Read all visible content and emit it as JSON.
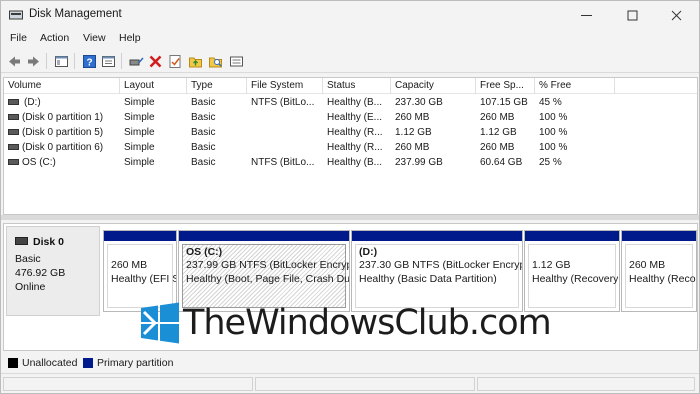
{
  "window": {
    "title": "Disk Management",
    "minimize_icon": "minimize-icon",
    "maximize_icon": "maximize-icon",
    "close_icon": "close-icon"
  },
  "menu": [
    "File",
    "Action",
    "View",
    "Help"
  ],
  "toolbar": {
    "icons": [
      "back-arrow-icon",
      "forward-arrow-icon",
      "console-tree-icon",
      "help-icon",
      "properties-icon",
      "connect-drive-icon",
      "delete-icon",
      "check-icon",
      "folder-up-icon",
      "search-icon",
      "list-view-icon"
    ]
  },
  "volume_table": {
    "columns": [
      "Volume",
      "Layout",
      "Type",
      "File System",
      "Status",
      "Capacity",
      "Free Sp...",
      "% Free"
    ],
    "rows": [
      {
        "volume": "(D:)",
        "layout": "Simple",
        "type": "Basic",
        "file_system": "NTFS (BitLo...",
        "status": "Healthy (B...",
        "capacity": "237.30 GB",
        "free": "107.15 GB",
        "pct": "45 %"
      },
      {
        "volume": "(Disk 0 partition 1)",
        "layout": "Simple",
        "type": "Basic",
        "file_system": "",
        "status": "Healthy (E...",
        "capacity": "260 MB",
        "free": "260 MB",
        "pct": "100 %"
      },
      {
        "volume": "(Disk 0 partition 5)",
        "layout": "Simple",
        "type": "Basic",
        "file_system": "",
        "status": "Healthy (R...",
        "capacity": "1.12 GB",
        "free": "1.12 GB",
        "pct": "100 %"
      },
      {
        "volume": "(Disk 0 partition 6)",
        "layout": "Simple",
        "type": "Basic",
        "file_system": "",
        "status": "Healthy (R...",
        "capacity": "260 MB",
        "free": "260 MB",
        "pct": "100 %"
      },
      {
        "volume": "OS (C:)",
        "layout": "Simple",
        "type": "Basic",
        "file_system": "NTFS (BitLo...",
        "status": "Healthy (B...",
        "capacity": "237.99 GB",
        "free": "60.64 GB",
        "pct": "25 %"
      }
    ]
  },
  "disk": {
    "name": "Disk 0",
    "type": "Basic",
    "size": "476.92 GB",
    "state": "Online",
    "partitions": [
      {
        "name": "",
        "line1": "260 MB",
        "line2": "Healthy (EFI S"
      },
      {
        "name": "OS  (C:)",
        "line1": "237.99 GB NTFS (BitLocker Encryp",
        "line2": "Healthy (Boot, Page File, Crash Du"
      },
      {
        "name": "(D:)",
        "line1": "237.30 GB NTFS (BitLocker Encryp",
        "line2": "Healthy (Basic Data Partition)"
      },
      {
        "name": "",
        "line1": "1.12 GB",
        "line2": "Healthy (Recovery"
      },
      {
        "name": "",
        "line1": "260 MB",
        "line2": "Healthy (Reco"
      }
    ]
  },
  "legend": {
    "unallocated": "Unallocated",
    "primary": "Primary partition",
    "unallocated_color": "#000000",
    "primary_color": "#001a8c"
  },
  "watermark": {
    "text": "TheWindowsClub.com",
    "logo_color": "#1a8fd6"
  }
}
